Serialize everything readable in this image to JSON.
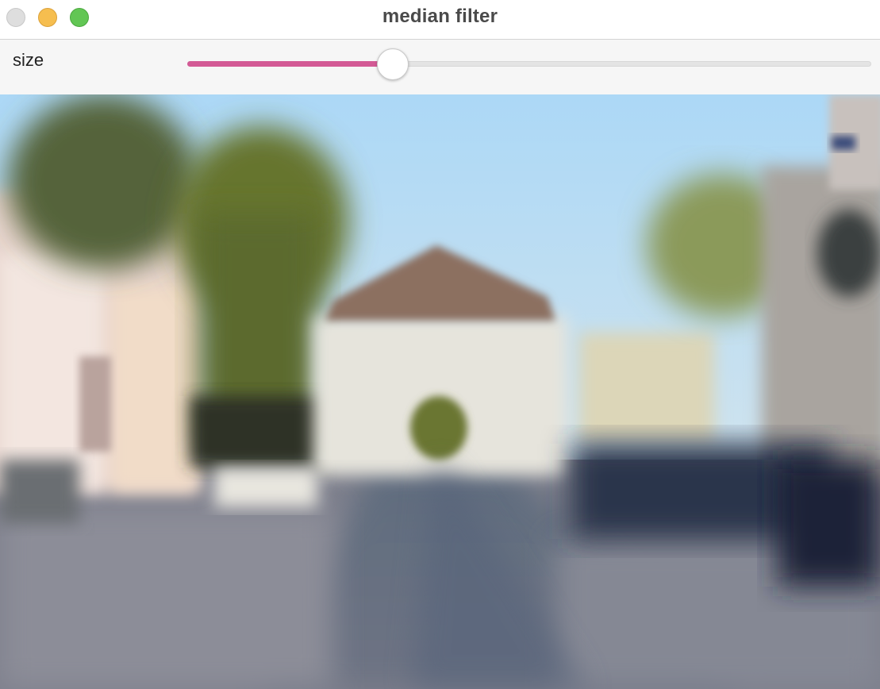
{
  "window": {
    "title": "median filter",
    "buttons": [
      "close-button",
      "minimize-button",
      "zoom-button"
    ]
  },
  "controls": {
    "size_label": "size",
    "size_slider": {
      "fraction": 0.3,
      "fill_color": "#d35a95"
    }
  },
  "image": {
    "description_icon": "blurred-street-scene-image"
  }
}
